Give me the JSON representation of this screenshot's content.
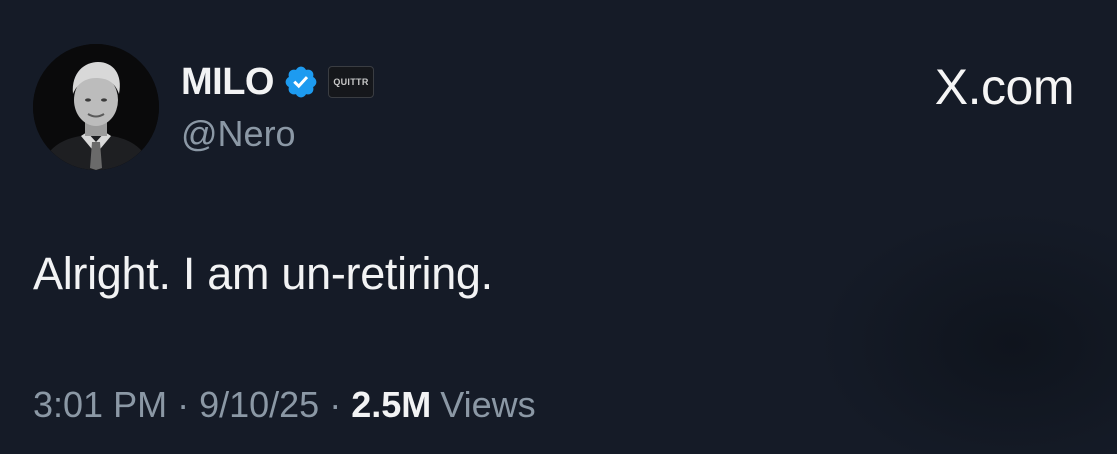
{
  "author": {
    "display_name": "MILO",
    "handle": "@Nero",
    "verified_icon": "verified-badge-icon",
    "affiliate_badge": "QUITTR",
    "verified_color": "#1d9bf0"
  },
  "brand": {
    "label": "X.com"
  },
  "tweet": {
    "text": "Alright. I am un-retiring.",
    "time": "3:01 PM",
    "date": "9/10/25",
    "separator": "·",
    "views_count": "2.5M",
    "views_label": "Views"
  },
  "colors": {
    "background": "#151b27",
    "primary_text": "#f2f3f4",
    "secondary_text": "#8b98a5"
  }
}
